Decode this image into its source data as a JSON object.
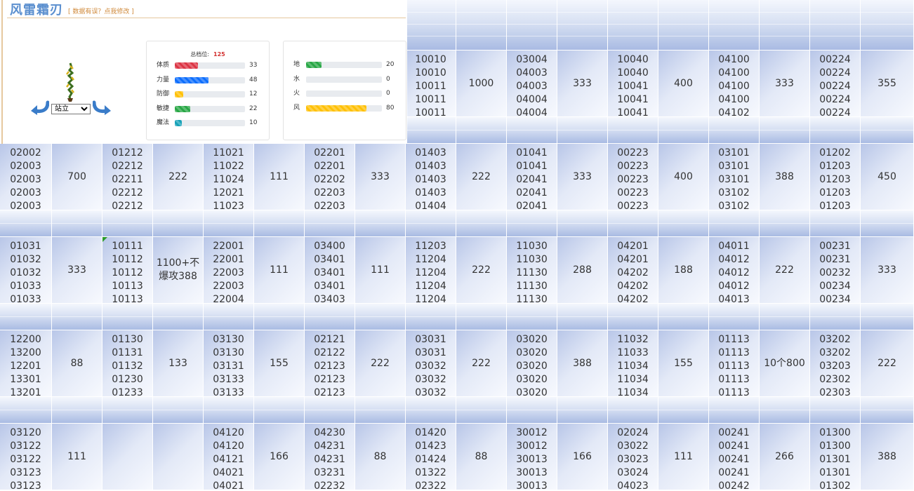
{
  "hero": {
    "name": "风雷霜刃",
    "fix_link": "[ 数据有误？点我修改 ]"
  },
  "stance": {
    "selected": "站立"
  },
  "stats": {
    "total_label": "总档位:",
    "total": 125,
    "items": [
      {
        "label": "体质",
        "value": 33,
        "color": "#dc3545"
      },
      {
        "label": "力量",
        "value": 48,
        "color": "#0d6efd"
      },
      {
        "label": "防御",
        "value": 12,
        "color": "#ffc107"
      },
      {
        "label": "敏捷",
        "value": 22,
        "color": "#28a745"
      },
      {
        "label": "魔法",
        "value": 10,
        "color": "#17a2b8"
      }
    ]
  },
  "elements": {
    "items": [
      {
        "label": "地",
        "value": 20,
        "color": "#28a745"
      },
      {
        "label": "水",
        "value": 0,
        "color": "#0d6efd"
      },
      {
        "label": "火",
        "value": 0,
        "color": "#dc3545"
      },
      {
        "label": "风",
        "value": 80,
        "color": "#ffc107"
      }
    ]
  },
  "grid": {
    "rows": [
      {
        "cells": [
          {
            "codes": [
              "10010",
              "10010",
              "10011",
              "10011",
              "10011"
            ],
            "value": "1000"
          },
          {
            "codes": [
              "03004",
              "04003",
              "04003",
              "04004",
              "04004"
            ],
            "value": "333"
          },
          {
            "codes": [
              "10040",
              "10040",
              "10041",
              "10041",
              "10041"
            ],
            "value": "400"
          },
          {
            "codes": [
              "04100",
              "04100",
              "04100",
              "04100",
              "04102"
            ],
            "value": "333"
          },
          {
            "codes": [
              "00224",
              "00224",
              "00224",
              "00224",
              "00224"
            ],
            "value": "355"
          }
        ]
      },
      {
        "cells": [
          {
            "codes": [
              "02002",
              "02003",
              "02003",
              "02003",
              "02003"
            ],
            "value": "700"
          },
          {
            "codes": [
              "01212",
              "02212",
              "02211",
              "02212",
              "02212"
            ],
            "value": "222"
          },
          {
            "codes": [
              "11021",
              "11022",
              "11024",
              "12021",
              "11023"
            ],
            "value": "111"
          },
          {
            "codes": [
              "02201",
              "02201",
              "02202",
              "02203",
              "02203"
            ],
            "value": "333"
          },
          {
            "codes": [
              "01403",
              "01403",
              "01403",
              "01403",
              "01404"
            ],
            "value": "222"
          },
          {
            "codes": [
              "01041",
              "01041",
              "02041",
              "02041",
              "02041"
            ],
            "value": "333"
          },
          {
            "codes": [
              "00223",
              "00223",
              "00223",
              "00223",
              "00223"
            ],
            "value": "400"
          },
          {
            "codes": [
              "03101",
              "03101",
              "03101",
              "03102",
              "03102"
            ],
            "value": "388"
          },
          {
            "codes": [
              "01202",
              "01203",
              "01203",
              "01203",
              "01203"
            ],
            "value": "450"
          }
        ]
      },
      {
        "cells": [
          {
            "codes": [
              "01031",
              "01032",
              "01032",
              "01033",
              "01033"
            ],
            "value": "333"
          },
          {
            "codes": [
              "10111",
              "10112",
              "10112",
              "10113",
              "10113"
            ],
            "value": "1100+不爆攻388",
            "marked": true
          },
          {
            "codes": [
              "22001",
              "22001",
              "22003",
              "22003",
              "22004"
            ],
            "value": "111"
          },
          {
            "codes": [
              "03400",
              "03401",
              "03401",
              "03401",
              "03403"
            ],
            "value": "111"
          },
          {
            "codes": [
              "11203",
              "11204",
              "11204",
              "11204",
              "11204"
            ],
            "value": "222"
          },
          {
            "codes": [
              "11030",
              "11030",
              "11130",
              "11130",
              "11130"
            ],
            "value": "288"
          },
          {
            "codes": [
              "04201",
              "04201",
              "04202",
              "04202",
              "04202"
            ],
            "value": "188"
          },
          {
            "codes": [
              "04011",
              "04012",
              "04012",
              "04012",
              "04013"
            ],
            "value": "222"
          },
          {
            "codes": [
              "00231",
              "00231",
              "00232",
              "00234",
              "00234"
            ],
            "value": "333"
          }
        ]
      },
      {
        "cells": [
          {
            "codes": [
              "12200",
              "13200",
              "12201",
              "13301",
              "13201"
            ],
            "value": "88"
          },
          {
            "codes": [
              "01130",
              "01131",
              "01132",
              "01230",
              "01233"
            ],
            "value": "133"
          },
          {
            "codes": [
              "03130",
              "03130",
              "03131",
              "03133",
              "03133"
            ],
            "value": "155"
          },
          {
            "codes": [
              "02121",
              "02122",
              "02123",
              "02123",
              "02123"
            ],
            "value": "222"
          },
          {
            "codes": [
              "03031",
              "03031",
              "03032",
              "03032",
              "03032"
            ],
            "value": "222"
          },
          {
            "codes": [
              "03020",
              "03020",
              "03020",
              "03020",
              "03020"
            ],
            "value": "388"
          },
          {
            "codes": [
              "11032",
              "11033",
              "11034",
              "11034",
              "11034"
            ],
            "value": "155"
          },
          {
            "codes": [
              "01113",
              "01113",
              "01113",
              "01113",
              "01113"
            ],
            "value": "10个800"
          },
          {
            "codes": [
              "03202",
              "03202",
              "03203",
              "02302",
              "02303"
            ],
            "value": "222"
          }
        ]
      },
      {
        "cells": [
          {
            "codes": [
              "03120",
              "03122",
              "03122",
              "03123",
              "03123"
            ],
            "value": "111"
          },
          {
            "codes": [
              "",
              "",
              "",
              "",
              ""
            ],
            "value": ""
          },
          {
            "codes": [
              "04120",
              "04120",
              "04121",
              "04021",
              "04021"
            ],
            "value": "166"
          },
          {
            "codes": [
              "04230",
              "04231",
              "04231",
              "03231",
              "02232"
            ],
            "value": "88"
          },
          {
            "codes": [
              "01420",
              "01423",
              "01424",
              "01322",
              "02322"
            ],
            "value": "88"
          },
          {
            "codes": [
              "30012",
              "30012",
              "30013",
              "30013",
              "30013"
            ],
            "value": "166"
          },
          {
            "codes": [
              "02024",
              "03022",
              "03023",
              "03024",
              "04023"
            ],
            "value": "111"
          },
          {
            "codes": [
              "00241",
              "00241",
              "00241",
              "00241",
              "00242"
            ],
            "value": "266"
          },
          {
            "codes": [
              "01300",
              "01300",
              "01301",
              "01301",
              "01302"
            ],
            "value": "388"
          }
        ]
      }
    ]
  }
}
